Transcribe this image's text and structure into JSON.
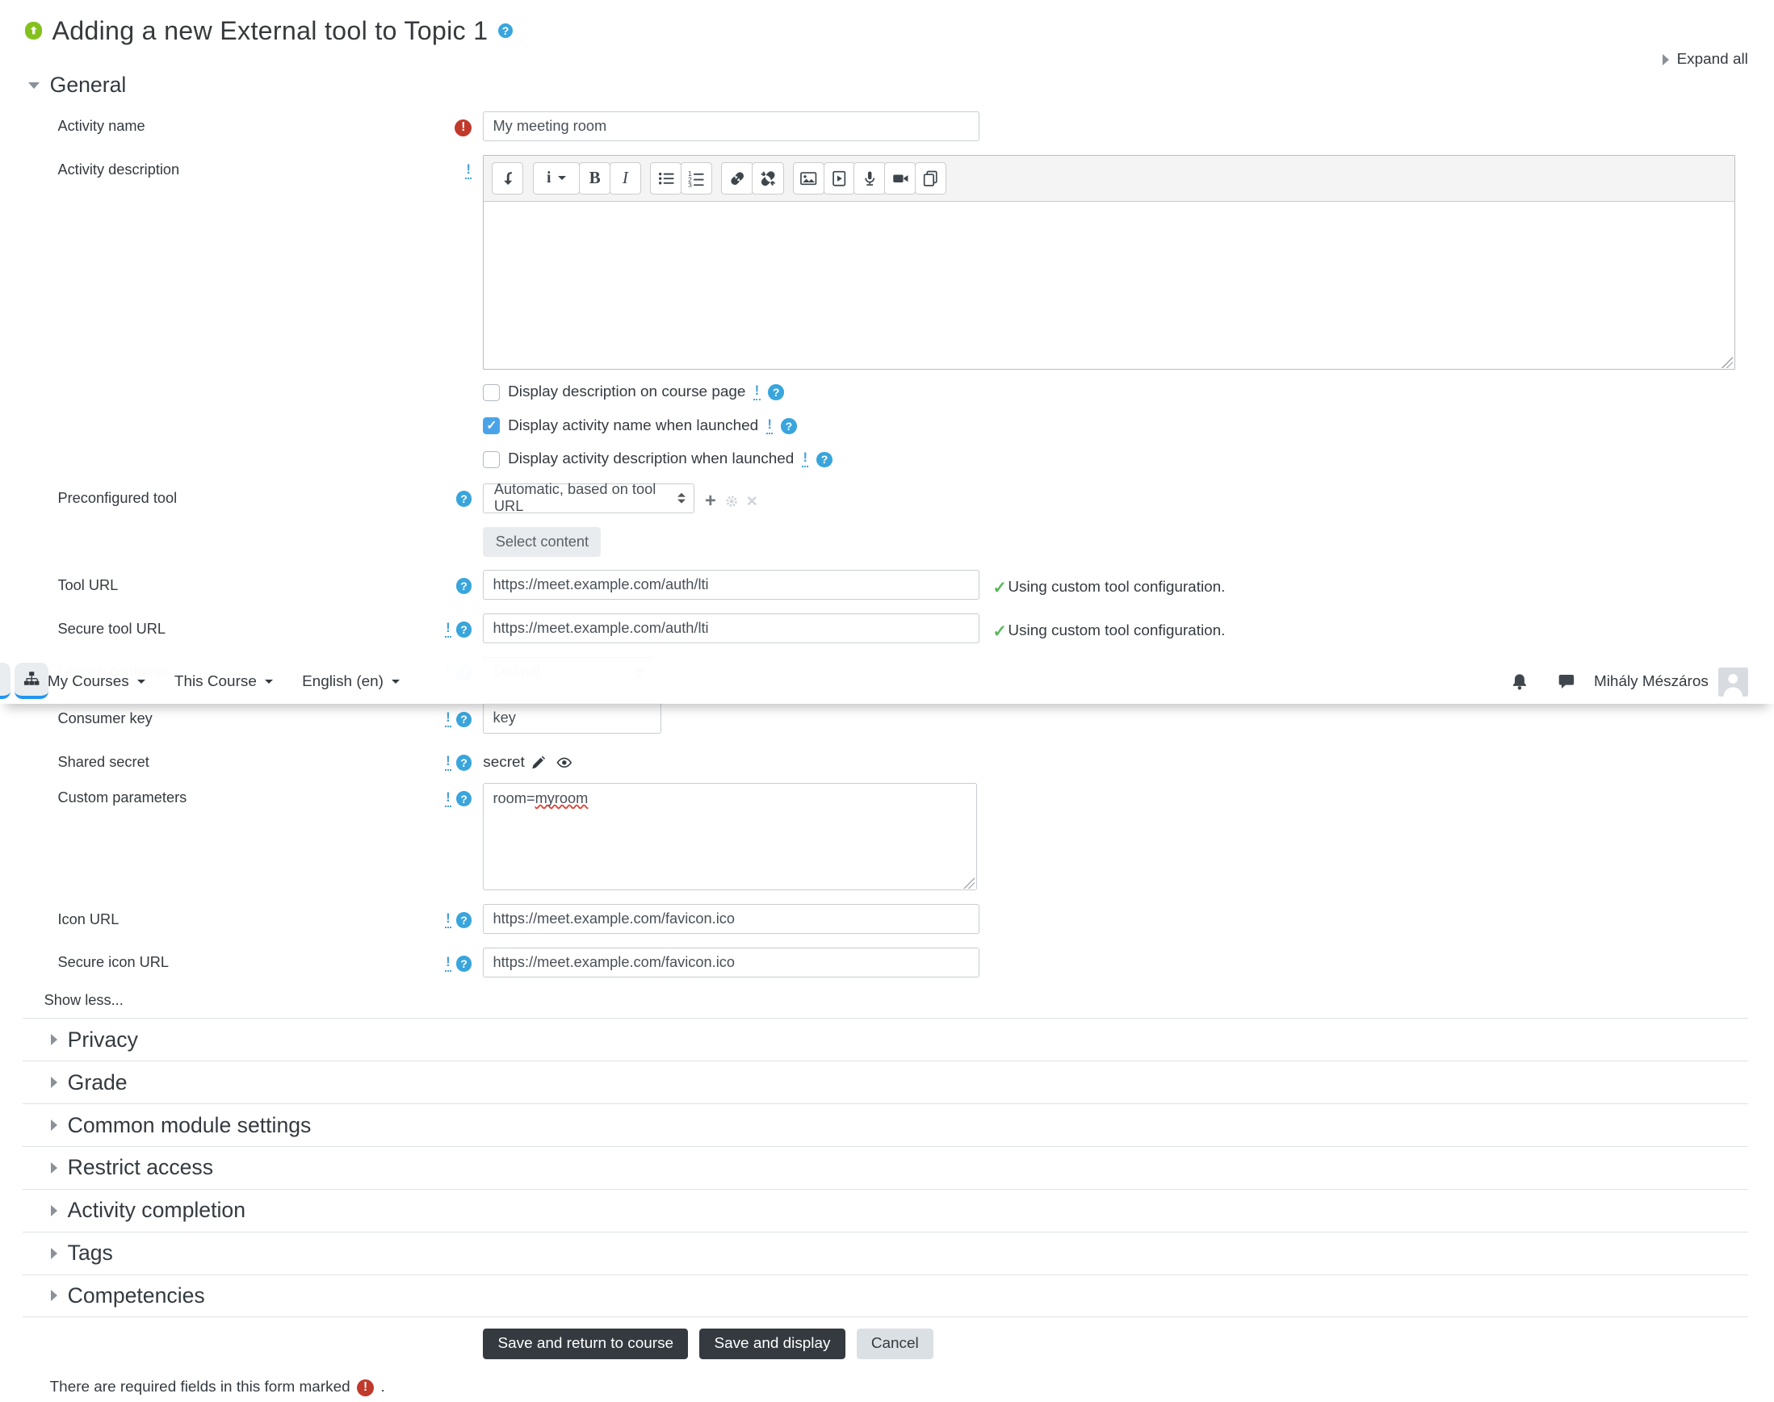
{
  "header": {
    "title": "Adding a new External tool to Topic 1",
    "expand_all": "Expand all"
  },
  "navbar": {
    "my_courses": "My Courses",
    "this_course": "This Course",
    "language": "English (en)",
    "user_name": "Mihály Mészáros"
  },
  "general_heading": "General",
  "fields": {
    "activity_name": {
      "label": "Activity name",
      "value": "My meeting room"
    },
    "activity_description": {
      "label": "Activity description"
    },
    "display_description": {
      "label": "Display description on course page",
      "checked": false
    },
    "display_name_launched": {
      "label": "Display activity name when launched",
      "checked": true
    },
    "display_desc_launched": {
      "label": "Display activity description when launched",
      "checked": false
    },
    "preconfigured_tool": {
      "label": "Preconfigured tool",
      "value": "Automatic, based on tool URL",
      "select_content": "Select content"
    },
    "tool_url": {
      "label": "Tool URL",
      "value": "https://meet.example.com/auth/lti",
      "status": "Using custom tool configuration."
    },
    "secure_tool_url": {
      "label": "Secure tool URL",
      "value": "https://meet.example.com/auth/lti",
      "status": "Using custom tool configuration."
    },
    "launch_container": {
      "label": "Launch container",
      "value": "Default"
    },
    "consumer_key": {
      "label": "Consumer key",
      "value": "key"
    },
    "shared_secret": {
      "label": "Shared secret",
      "value": "secret"
    },
    "custom_parameters": {
      "label": "Custom parameters",
      "value": "room=myroom",
      "value_prefix": "room=",
      "misspelled_word": "myroom"
    },
    "icon_url": {
      "label": "Icon URL",
      "value": "https://meet.example.com/favicon.ico"
    },
    "secure_icon_url": {
      "label": "Secure icon URL",
      "value": "https://meet.example.com/favicon.ico"
    }
  },
  "show_less": "Show less...",
  "sections": [
    "Privacy",
    "Grade",
    "Common module settings",
    "Restrict access",
    "Activity completion",
    "Tags",
    "Competencies"
  ],
  "editor": {
    "bold_glyph": "B",
    "italic_glyph": "I",
    "styles_glyph": "i",
    "toolbar_icons": [
      "collapse-toolbar-icon",
      "paragraph-styles-icon",
      "bold-icon",
      "italic-icon",
      "unordered-list-icon",
      "ordered-list-icon",
      "link-icon",
      "unlink-icon",
      "image-icon",
      "media-icon",
      "record-audio-icon",
      "record-video-icon",
      "manage-files-icon"
    ]
  },
  "glyphs": {
    "check": "✓",
    "plus": "+",
    "close": "×",
    "help": "?",
    "required": "!",
    "advanced": "!"
  },
  "actions": {
    "save_return": "Save and return to course",
    "save_display": "Save and display",
    "cancel": "Cancel"
  },
  "footer": {
    "required_note": "There are required fields in this form marked",
    "suffix": "."
  },
  "colors": {
    "accent_blue": "#2095f2",
    "help_blue": "#39a5dc",
    "checkbox_blue": "#4aa3e8",
    "required_red": "#c0392b",
    "success_green": "#5cb85c",
    "button_dark": "#343a40",
    "tool_green": "#85c11e"
  }
}
